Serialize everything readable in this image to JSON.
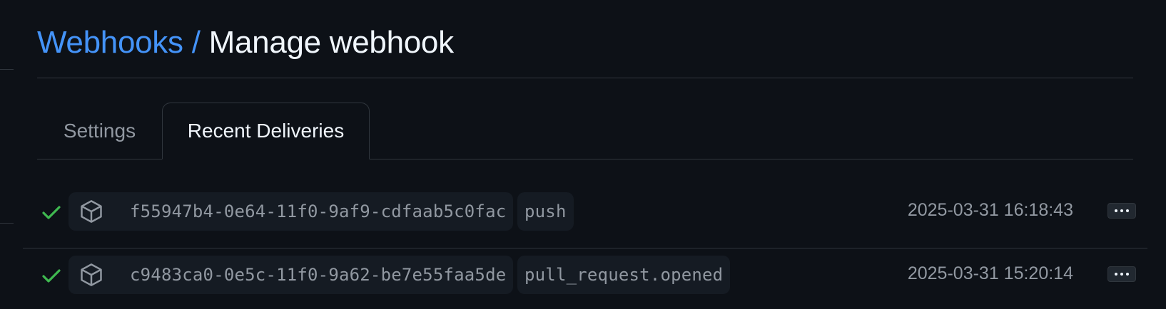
{
  "breadcrumb": {
    "parent_label": "Webhooks",
    "separator": "/",
    "current_label": "Manage webhook"
  },
  "tabs": [
    {
      "label": "Settings",
      "selected": false
    },
    {
      "label": "Recent Deliveries",
      "selected": true
    }
  ],
  "deliveries": [
    {
      "status": "success",
      "status_icon": "check-icon",
      "type_icon": "package-icon",
      "guid": "f55947b4-0e64-11f0-9af9-cdfaab5c0fac",
      "event": "push",
      "timestamp": "2025-03-31 16:18:43",
      "more_label": "…"
    },
    {
      "status": "success",
      "status_icon": "check-icon",
      "type_icon": "package-icon",
      "guid": "c9483ca0-0e5c-11f0-9a62-be7e55faa5de",
      "event": "pull_request.opened",
      "timestamp": "2025-03-31 15:20:14",
      "more_label": "…"
    }
  ],
  "colors": {
    "background": "#0d1117",
    "link": "#4493f8",
    "success": "#3fb950",
    "muted_text": "#9198a1",
    "border": "#30363d"
  }
}
